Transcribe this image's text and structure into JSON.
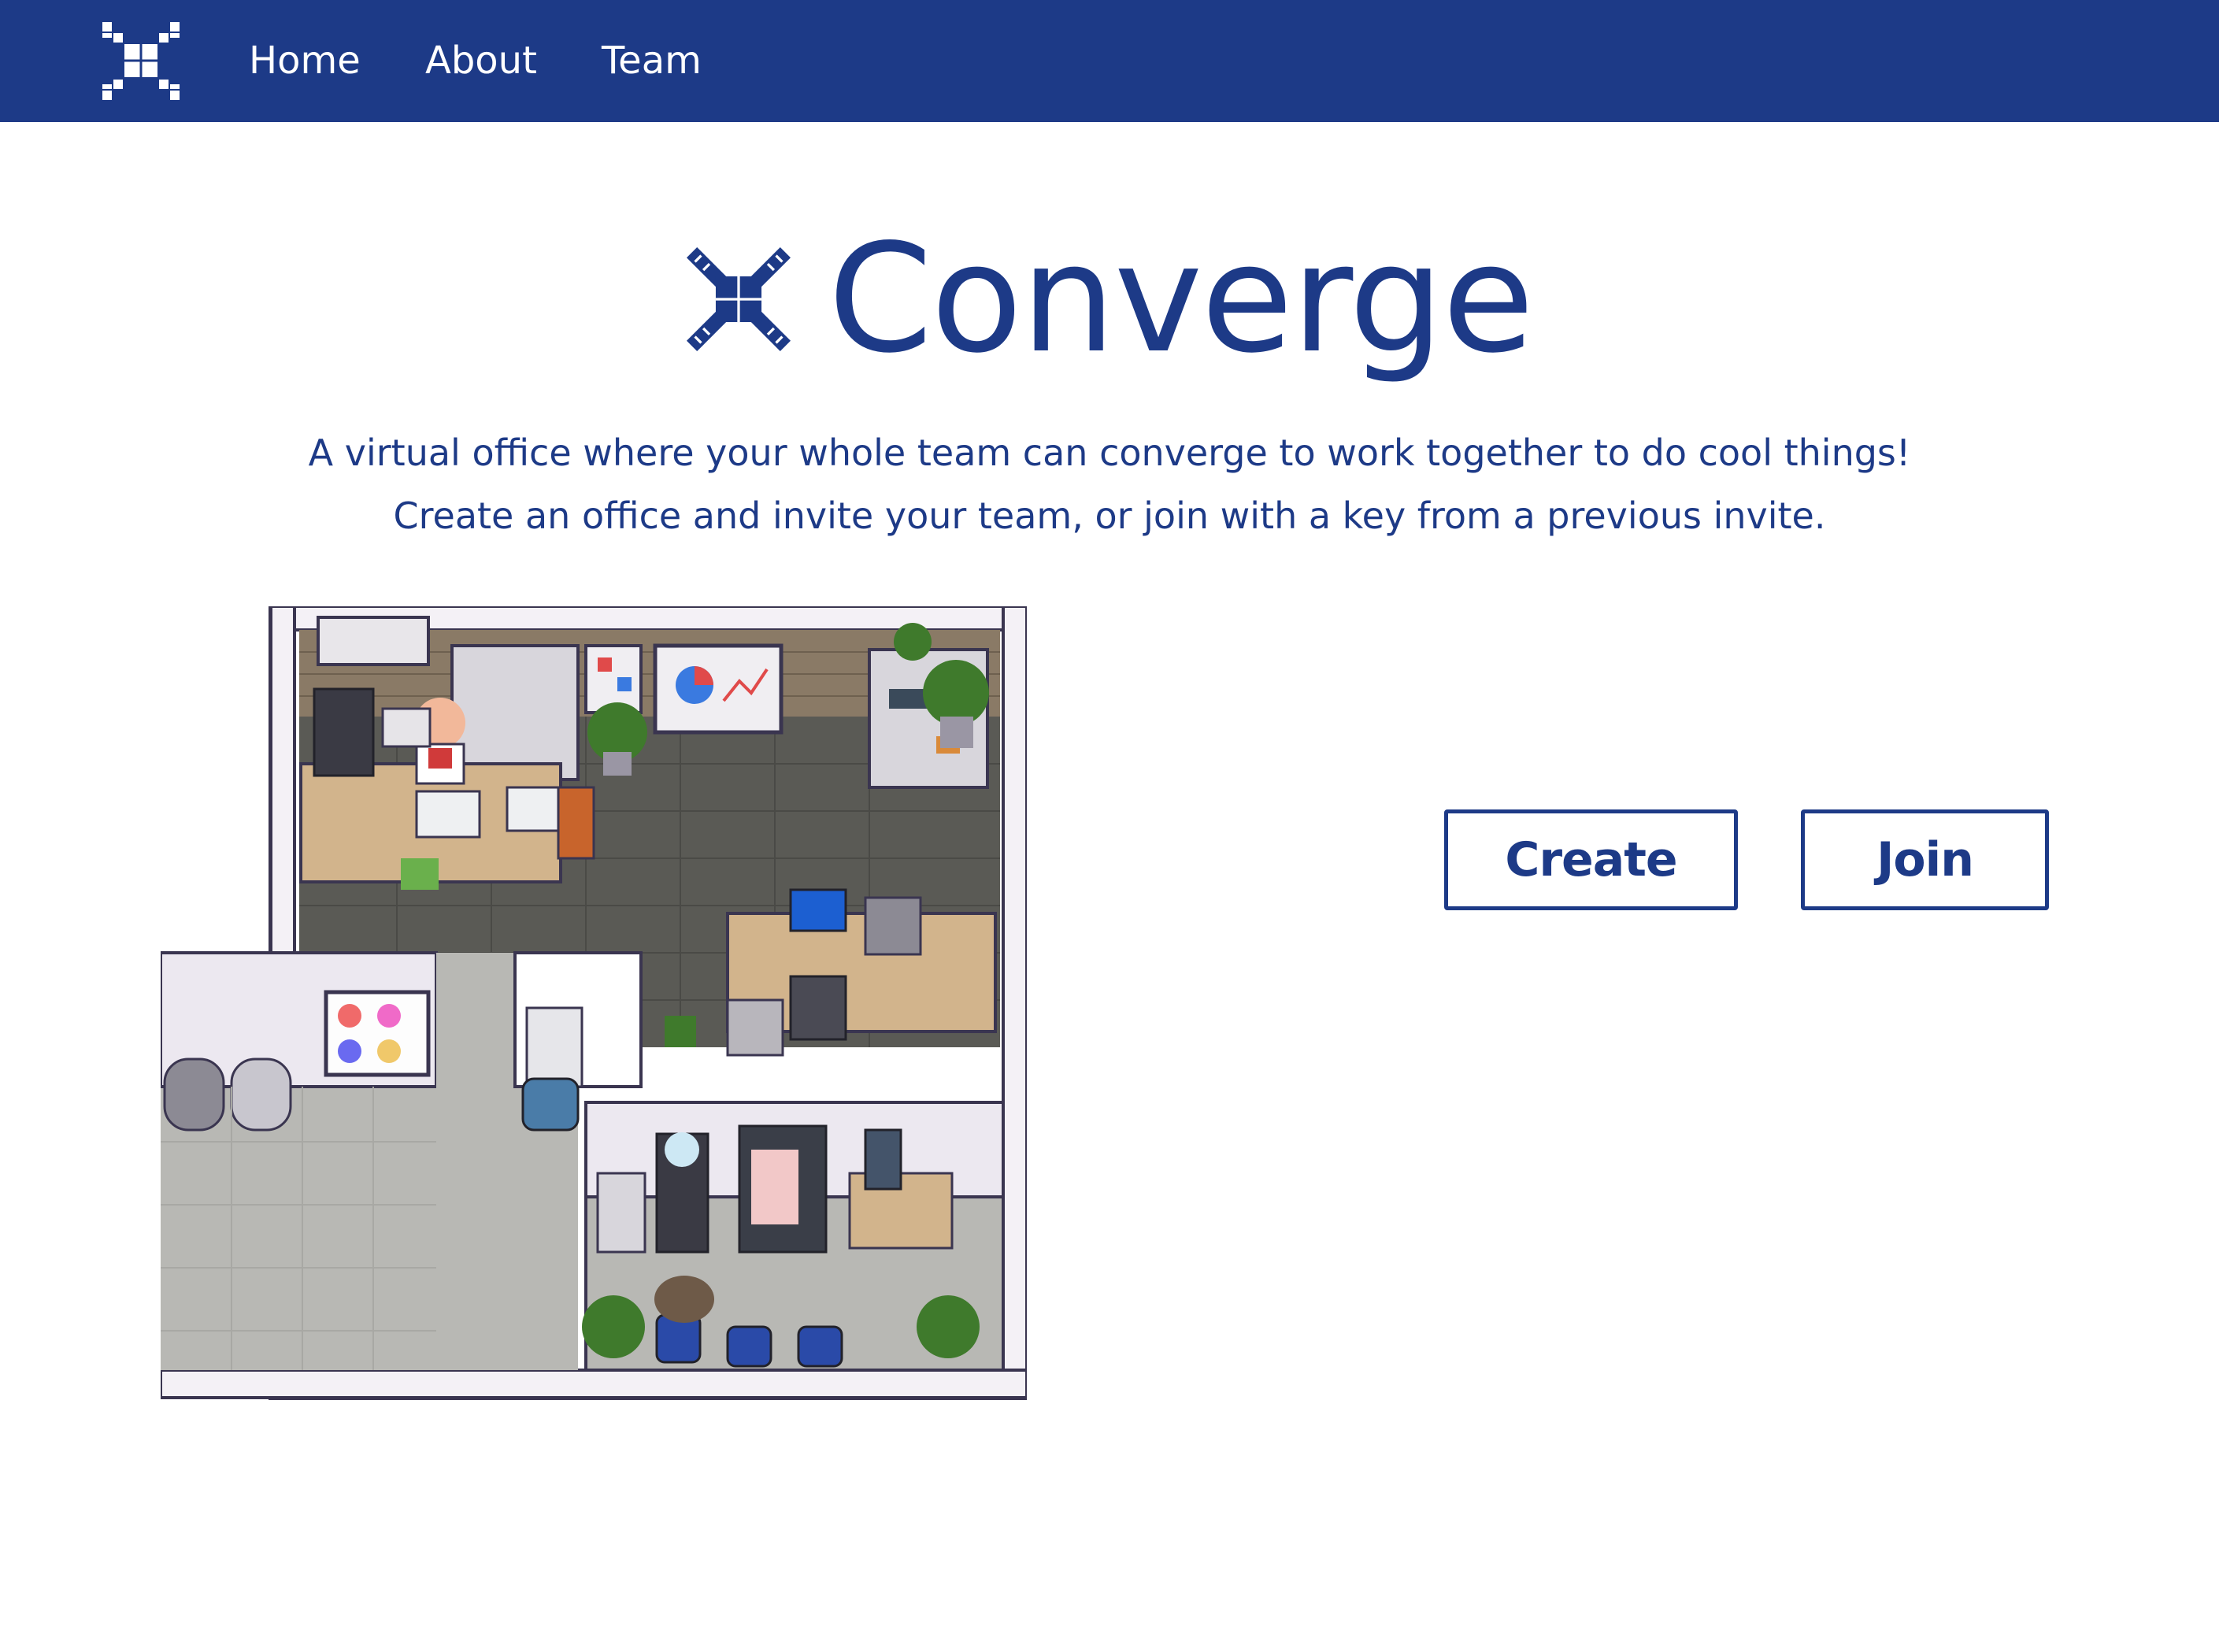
{
  "nav": {
    "logo_icon": "converge-x-logo-icon",
    "links": [
      {
        "label": "Home"
      },
      {
        "label": "About"
      },
      {
        "label": "Team"
      }
    ]
  },
  "hero": {
    "title": "Converge",
    "logo_icon": "converge-x-logo-icon",
    "tagline_1": "A virtual office where your whole team can converge to work together to do cool things!",
    "tagline_2": "Create an office and invite your team, or join with a key from a previous invite."
  },
  "illustration": {
    "icon": "pixel-office-illustration"
  },
  "actions": {
    "create_label": "Create",
    "join_label": "Join"
  },
  "colors": {
    "brand": "#1d3a87",
    "background": "#ffffff"
  }
}
